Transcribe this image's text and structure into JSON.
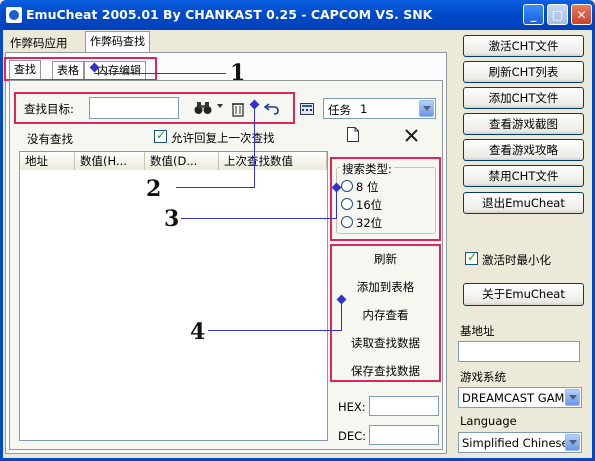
{
  "window": {
    "title": "EmuCheat 2005.01  By CHANKAST 0.25 - CAPCOM VS. SNK"
  },
  "main_tabs": [
    "作弊码应用",
    "作弊码查找"
  ],
  "sub_tabs": [
    "查找",
    "表格",
    "内存编辑"
  ],
  "search": {
    "target_label": "查找目标:",
    "target_value": "",
    "task_label": "任务",
    "task_value": "1",
    "status": "没有查找",
    "allow_restore_label": "允许回复上一次查找",
    "columns": [
      "地址",
      "数值(H...",
      "数值(D...",
      "上次查找数值"
    ],
    "search_type_title": "搜索类型:",
    "search_types": [
      "8 位",
      "16位",
      "32位"
    ],
    "actions": [
      "刷新",
      "添加到表格",
      "内存查看",
      "读取查找数据",
      "保存查找数据"
    ],
    "hex_label": "HEX:",
    "dec_label": "DEC:"
  },
  "right_buttons": [
    "激活CHT文件",
    "刷新CHT列表",
    "添加CHT文件",
    "查看游戏截图",
    "查看游戏攻略",
    "禁用CHT文件",
    "退出EmuCheat"
  ],
  "minimize_label": "激活时最小化",
  "about_label": "关于EmuCheat",
  "base_addr_label": "基地址",
  "base_addr_value": "",
  "game_system_label": "游戏系统",
  "game_system_value": "DREAMCAST GAME",
  "language_label": "Language",
  "language_value": "Simplified Chinese",
  "callouts": [
    "1",
    "2",
    "3",
    "4"
  ],
  "icons": [
    "binoculars-icon",
    "trash-icon",
    "undo-icon",
    "calculator-icon",
    "new-file-icon",
    "close-x-icon"
  ],
  "colors": {
    "title_bar": "#0049C9",
    "highlight_box": "#E0245E",
    "callout_line": "#3333CC",
    "window_bg": "#ECE9D8"
  }
}
